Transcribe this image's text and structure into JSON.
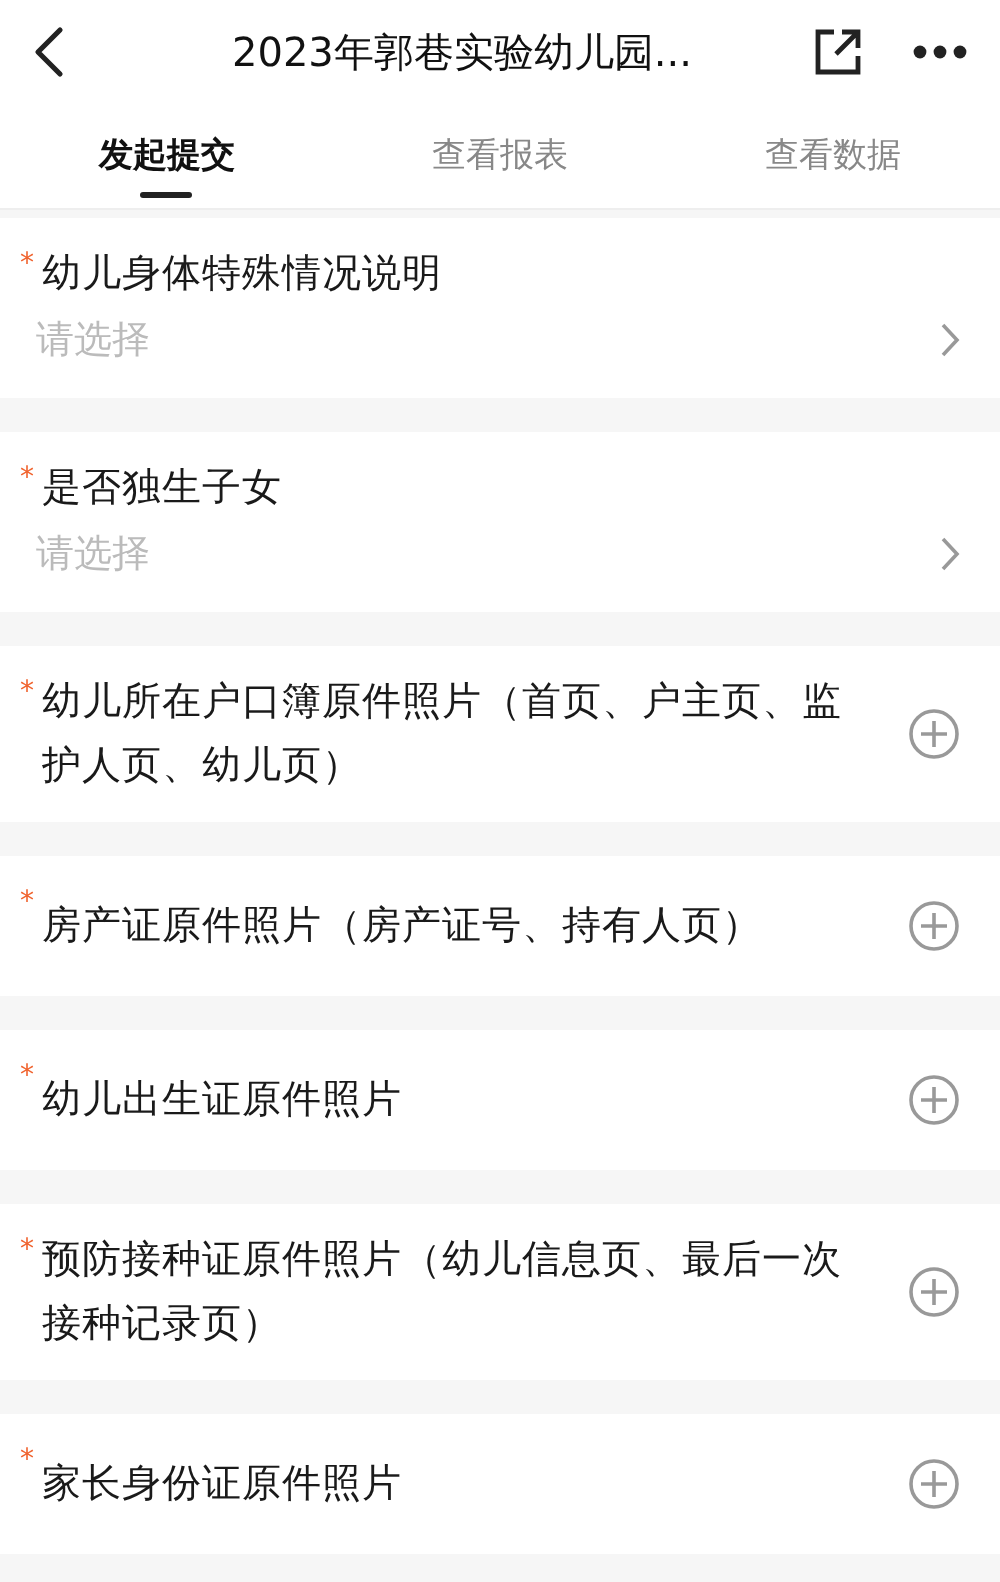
{
  "header": {
    "title": "2023年郭巷实验幼儿园..."
  },
  "tabs": [
    {
      "label": "发起提交",
      "selected": true
    },
    {
      "label": "查看报表",
      "selected": false
    },
    {
      "label": "查看数据",
      "selected": false
    }
  ],
  "fields": [
    {
      "kind": "select",
      "marker": "*",
      "label": "幼儿身体特殊情况说明",
      "placeholder": "请选择"
    },
    {
      "kind": "select",
      "marker": "*",
      "label": "是否独生子女",
      "placeholder": "请选择"
    },
    {
      "kind": "upload",
      "marker": "*",
      "label": "幼儿所在户口簿原件照片（首页、户主页、监护人页、幼儿页）"
    },
    {
      "kind": "upload",
      "marker": "*",
      "label": "房产证原件照片（房产证号、持有人页）"
    },
    {
      "kind": "upload",
      "marker": "*",
      "label": "幼儿出生证原件照片"
    },
    {
      "kind": "upload",
      "marker": "*",
      "label": "预防接种证原件照片（幼儿信息页、最后一次接种记录页）"
    },
    {
      "kind": "upload",
      "marker": "*",
      "label": "家长身份证原件照片"
    }
  ]
}
